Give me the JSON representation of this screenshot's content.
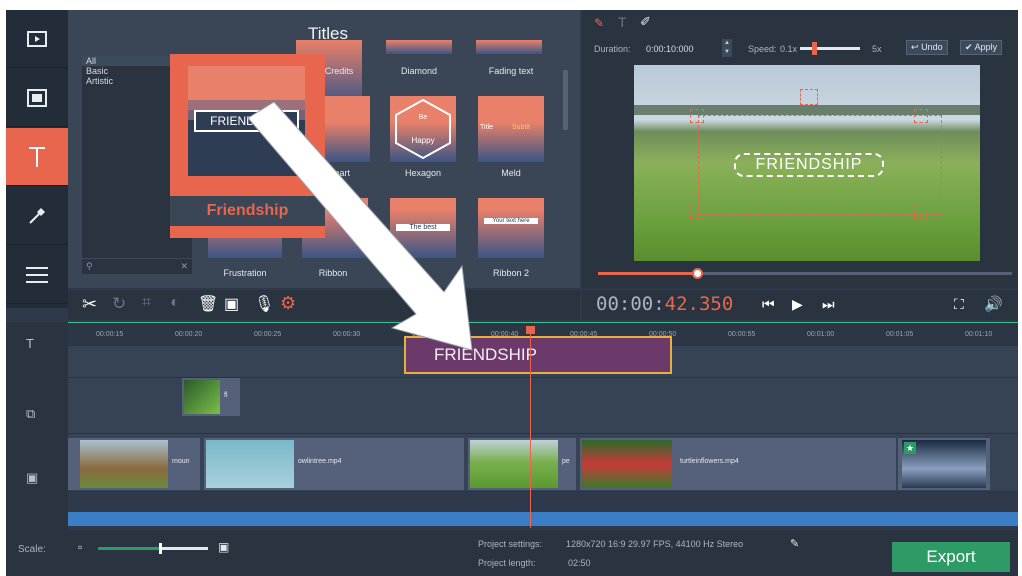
{
  "titles_panel": {
    "heading": "Titles",
    "categories": [
      "All",
      "Basic",
      "Artistic"
    ],
    "tiles": [
      {
        "label": "Credits"
      },
      {
        "label": "Diamond"
      },
      {
        "label": "Fading text"
      },
      {
        "label": "Heart"
      },
      {
        "label": "Hexagon"
      },
      {
        "label": "Meld"
      },
      {
        "label": "Frustration"
      },
      {
        "label": "Ribbon"
      },
      {
        "label": "Ribbon 2"
      }
    ],
    "tile_texts": {
      "hexagon_top": "Be",
      "hexagon_bottom": "Happy",
      "meld_left": "Title",
      "meld_right": "Subtit",
      "ribbon_left": "The best",
      "ribbon2": "Your text here"
    },
    "highlighted": {
      "label": "Friendship",
      "banner_text": "FRIENDSHIP"
    }
  },
  "preview": {
    "duration_label": "Duration:",
    "duration_value": "0:00:10:000",
    "speed_label": "Speed:",
    "speed_min": "0.1x",
    "speed_max": "5x",
    "speed_level": 0.2,
    "undo_label": "Undo",
    "apply_label": "Apply",
    "overlay_text": "FRIENDSHIP",
    "seek_progress": 0.24
  },
  "playback": {
    "timecode_main": "00:00:",
    "timecode_accent": "42.350"
  },
  "timeline": {
    "ticks": [
      "00:00:15",
      "00:00:20",
      "00:00:25",
      "00:00:30",
      "00:00:35",
      "00:00:40",
      "00:00:45",
      "00:00:50",
      "00:00:55",
      "00:01:00",
      "00:01:05",
      "00:01:10"
    ],
    "title_clip": "FRIENDSHIP",
    "overlay_clip": "fl",
    "video_clips": [
      "moun",
      "owlintree.mp4",
      "pe",
      "turtleinflowers.mp4"
    ]
  },
  "bottom": {
    "scale_label": "Scale:",
    "scale_level": 0.55,
    "project_settings_label": "Project settings:",
    "project_settings_value": "1280x720 16:9 29.97 FPS, 44100 Hz Stereo",
    "project_length_label": "Project length:",
    "project_length_value": "02:50",
    "export_label": "Export"
  },
  "colors": {
    "accent": "#e8664e",
    "export": "#2e9a65",
    "title_clip": "#6b3a6a"
  }
}
